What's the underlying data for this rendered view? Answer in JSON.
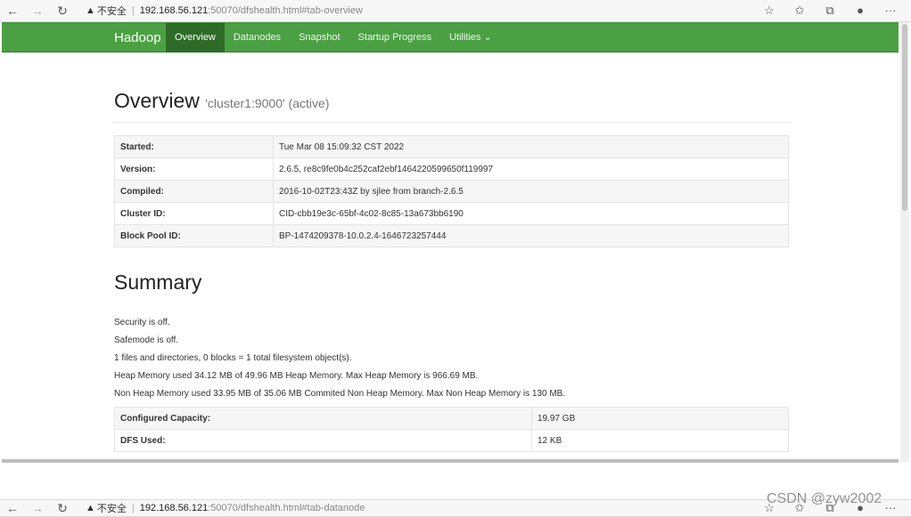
{
  "browser_top": {
    "insecure": "不安全",
    "host": "192.168.56.121",
    "path": ":50070/dfshealth.html#tab-overview"
  },
  "browser_bottom": {
    "insecure": "不安全",
    "host": "192.168.56.121",
    "path": ":50070/dfshealth.html#tab-datanode"
  },
  "nav": {
    "brand": "Hadoop",
    "items": [
      "Overview",
      "Datanodes",
      "Snapshot",
      "Startup Progress",
      "Utilities ⌄"
    ]
  },
  "overview": {
    "title": "Overview",
    "subtitle": "'cluster1:9000' (active)",
    "rows": [
      {
        "k": "Started:",
        "v": "Tue Mar 08 15:09:32 CST 2022"
      },
      {
        "k": "Version:",
        "v": "2.6.5, re8c9fe0b4c252caf2ebf1464220599650f119997"
      },
      {
        "k": "Compiled:",
        "v": "2016-10-02T23:43Z by sjlee from branch-2.6.5"
      },
      {
        "k": "Cluster ID:",
        "v": "CID-cbb19e3c-65bf-4c02-8c85-13a673bb6190"
      },
      {
        "k": "Block Pool ID:",
        "v": "BP-1474209378-10.0.2.4-1646723257444"
      }
    ]
  },
  "summary": {
    "title": "Summary",
    "lines": [
      "Security is off.",
      "Safemode is off.",
      "1 files and directories, 0 blocks = 1 total filesystem object(s).",
      "Heap Memory used 34.12 MB of 49.96 MB Heap Memory. Max Heap Memory is 966.69 MB.",
      "Non Heap Memory used 33.95 MB of 35.06 MB Commited Non Heap Memory. Max Non Heap Memory is 130 MB."
    ],
    "rows": [
      {
        "k": "Configured Capacity:",
        "v": "19.97 GB"
      },
      {
        "k": "DFS Used:",
        "v": "12 KB"
      }
    ]
  },
  "watermark": "CSDN @zyw2002"
}
